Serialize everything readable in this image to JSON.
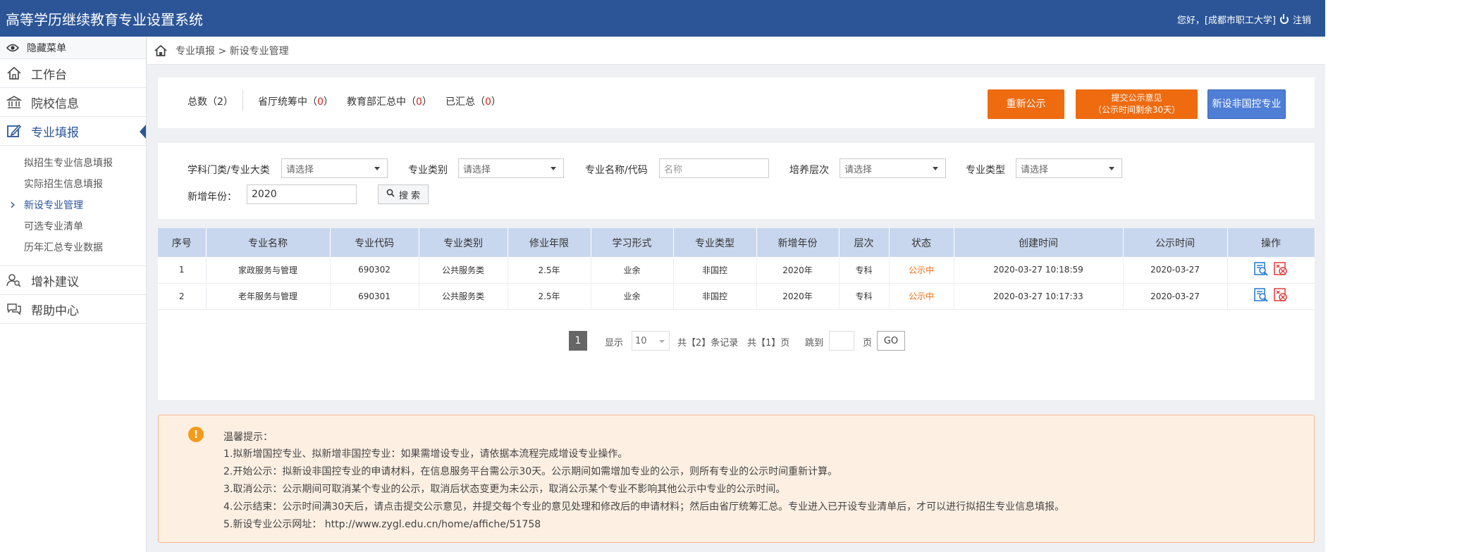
{
  "header": {
    "title": "高等学历继续教育专业设置系统",
    "user_text": "您好，[成都市职工大学]",
    "logout_label": "注销"
  },
  "sidebar": {
    "toggle_label": "隐藏菜单",
    "items": [
      {
        "label": "工作台",
        "icon": "home-icon"
      },
      {
        "label": "院校信息",
        "icon": "bank-icon"
      },
      {
        "label": "专业填报",
        "icon": "edit-icon"
      },
      {
        "label": "增补建议",
        "icon": "user-search-icon"
      },
      {
        "label": "帮助中心",
        "icon": "chat-icon"
      }
    ],
    "sub_items": [
      "拟招生专业信息填报",
      "实际招生信息填报",
      "新设专业管理",
      "可选专业清单",
      "历年汇总专业数据"
    ]
  },
  "breadcrumb": {
    "text": "专业填报 > 新设专业管理"
  },
  "stats": {
    "total_label": "总数（",
    "total_value": "2",
    "total_end": "）",
    "prov_label": "省厅统筹中（",
    "prov_value": "0",
    "prov_end": "）",
    "moe_label": "教育部汇总中（",
    "moe_value": "0",
    "moe_end": "）",
    "done_label": "已汇总（",
    "done_value": "0",
    "done_end": "）"
  },
  "actions": {
    "republish": "重新公示",
    "submit_line1": "提交公示意见",
    "submit_line2": "（公示时间剩余30天）",
    "new_non_state": "新设非国控专业"
  },
  "filters": {
    "discipline_label": "学科门类/专业大类",
    "discipline_value": "请选择",
    "category_label": "专业类别",
    "category_value": "请选择",
    "name_label": "专业名称/代码",
    "name_placeholder": "名称",
    "level_label": "培养层次",
    "level_value": "请选择",
    "type_label": "专业类型",
    "type_value": "请选择",
    "year_label": "新增年份：",
    "year_value": "2020",
    "search_label": "搜 索"
  },
  "table": {
    "headers": [
      "序号",
      "专业名称",
      "专业代码",
      "专业类别",
      "修业年限",
      "学习形式",
      "专业类型",
      "新增年份",
      "层次",
      "状态",
      "创建时间",
      "公示时间",
      "操作"
    ],
    "rows": [
      [
        "1",
        "家政服务与管理",
        "690302",
        "公共服务类",
        "2.5年",
        "业余",
        "非国控",
        "2020年",
        "专科",
        "公示中",
        "2020-03-27 10:18:59",
        "2020-03-27"
      ],
      [
        "2",
        "老年服务与管理",
        "690301",
        "公共服务类",
        "2.5年",
        "业余",
        "非国控",
        "2020年",
        "专科",
        "公示中",
        "2020-03-27 10:17:33",
        "2020-03-27"
      ]
    ]
  },
  "pager": {
    "current_page": "1",
    "show_label": "显示",
    "page_size": "10",
    "total_text": "共【2】条记录",
    "pages_text": "共【1】页",
    "jump_label": "跳到",
    "page_unit": "页",
    "go_label": "GO"
  },
  "tips": {
    "title": "温馨提示：",
    "lines": [
      "1.拟新增国控专业、拟新增非国控专业：如果需增设专业，请依据本流程完成增设专业操作。",
      "2.开始公示：拟新设非国控专业的申请材料，在信息服务平台需公示30天。公示期间如需增加专业的公示，则所有专业的公示时间重新计算。",
      "3.取消公示：公示期间可取消某个专业的公示，取消后状态变更为未公示，取消公示某个专业不影响其他公示中专业的公示时间。",
      "4.公示结束：公示时间满30天后，请点击提交公示意见，并提交每个专业的意见处理和修改后的申请材料；然后由省厅统筹汇总。专业进入已开设专业清单后，才可以进行拟招生专业信息填报。",
      "5.新设专业公示网址： http://www.zygl.edu.cn/home/affiche/51758"
    ]
  },
  "colors": {
    "header_bg": "#2b5597",
    "accent_orange": "#ee6b10",
    "accent_blue": "#4e7ed6",
    "status_orange": "#ee6b10",
    "count_red": "#e2231a"
  }
}
